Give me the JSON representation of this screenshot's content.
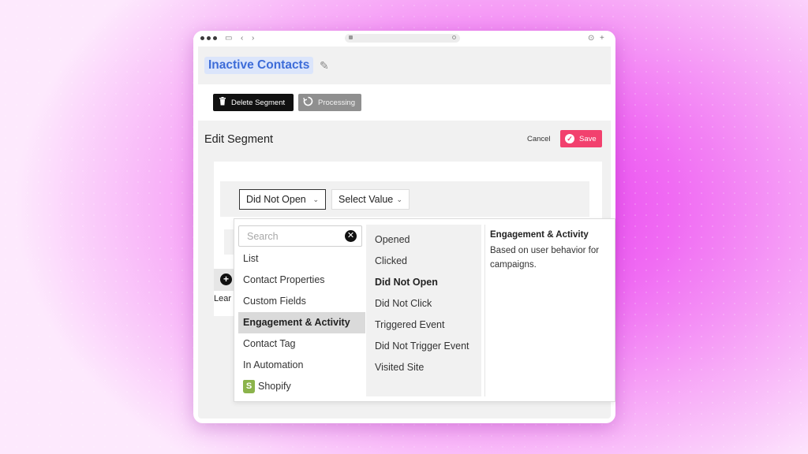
{
  "segment": {
    "name": "Inactive Contacts"
  },
  "actions": {
    "delete_label": "Delete Segment",
    "processing_label": "Processing"
  },
  "editor": {
    "title": "Edit Segment",
    "cancel_label": "Cancel",
    "save_label": "Save"
  },
  "rule": {
    "condition_value": "Did Not Open",
    "value_placeholder": "Select Value",
    "learn_label": "Lear"
  },
  "dropdown": {
    "search_placeholder": "Search",
    "categories": [
      {
        "label": "List"
      },
      {
        "label": "Contact Properties"
      },
      {
        "label": "Custom Fields"
      },
      {
        "label": "Engagement & Activity"
      },
      {
        "label": "Contact Tag"
      },
      {
        "label": "In Automation"
      },
      {
        "label": "Shopify"
      }
    ],
    "active_category": "Engagement & Activity",
    "options": [
      {
        "label": "Opened"
      },
      {
        "label": "Clicked"
      },
      {
        "label": "Did Not Open"
      },
      {
        "label": "Did Not Click"
      },
      {
        "label": "Triggered Event"
      },
      {
        "label": "Did Not Trigger Event"
      },
      {
        "label": "Visited Site"
      }
    ],
    "selected_option": "Did Not Open",
    "description": {
      "title": "Engagement & Activity",
      "text": "Based on user behavior for campaigns."
    }
  },
  "colors": {
    "accent_blue": "#3d6cd8",
    "title_chip_bg": "#dbe5fb",
    "save_pink": "#f2416e",
    "background_magenta": "#e83df0"
  },
  "icons": {
    "delete": "trash-icon",
    "processing": "refresh-icon",
    "save": "check-circle-icon",
    "edit_title": "pencil-icon",
    "clear_search": "close-circle-icon",
    "add_rule": "plus-circle-icon",
    "shopify": "shopify-bag-icon"
  }
}
